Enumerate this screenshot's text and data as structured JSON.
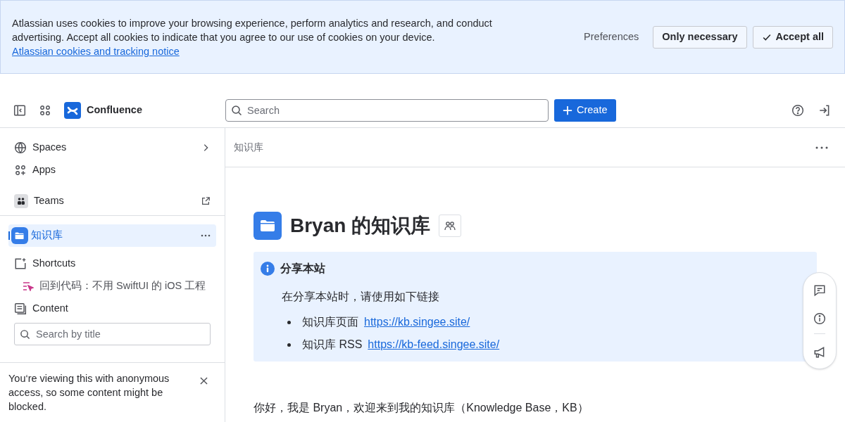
{
  "cookie_banner": {
    "text": "Atlassian uses cookies to improve your browsing experience, perform analytics and research, and conduct advertising. Accept all cookies to indicate that you agree to our use of cookies on your device.",
    "link": "Atlassian cookies and tracking notice",
    "buttons": [
      {
        "kind": "plain",
        "label": "Preferences"
      },
      {
        "kind": "outline",
        "label": "Only necessary"
      },
      {
        "kind": "accept",
        "label": "Accept all"
      }
    ]
  },
  "header": {
    "product": "Confluence",
    "search": {
      "placeholder": "Search"
    },
    "create": "Create"
  },
  "sidebar": {
    "nav": [
      {
        "kind": "globe",
        "label": "Spaces"
      },
      {
        "kind": "apps",
        "label": "Apps"
      },
      {
        "kind": "teams",
        "label": "Teams"
      }
    ],
    "space": {
      "label": "知识库",
      "selected": true
    },
    "shortcuts": {
      "label": "Shortcuts",
      "items": [
        "回到代码：不用 SwiftUI 的 iOS 工程"
      ]
    },
    "content": {
      "label": "Content",
      "search": {
        "placeholder": "Search by title"
      }
    },
    "notice": "You‘re viewing this with anonymous access, so some content might be blocked."
  },
  "breadcrumb": "知识库",
  "page": {
    "title": "Bryan 的知识库",
    "panel": {
      "title": "分享本站",
      "text": "在分享本站时，请使用如下链接",
      "links": [
        {
          "label": "知识库页面",
          "url": "https://kb.singee.site/"
        },
        {
          "label": "知识库 RSS",
          "url": "https://kb-feed.singee.site/"
        }
      ]
    },
    "intro": "你好，我是 Bryan，欢迎来到我的知识库（Knowledge Base，KB）"
  }
}
